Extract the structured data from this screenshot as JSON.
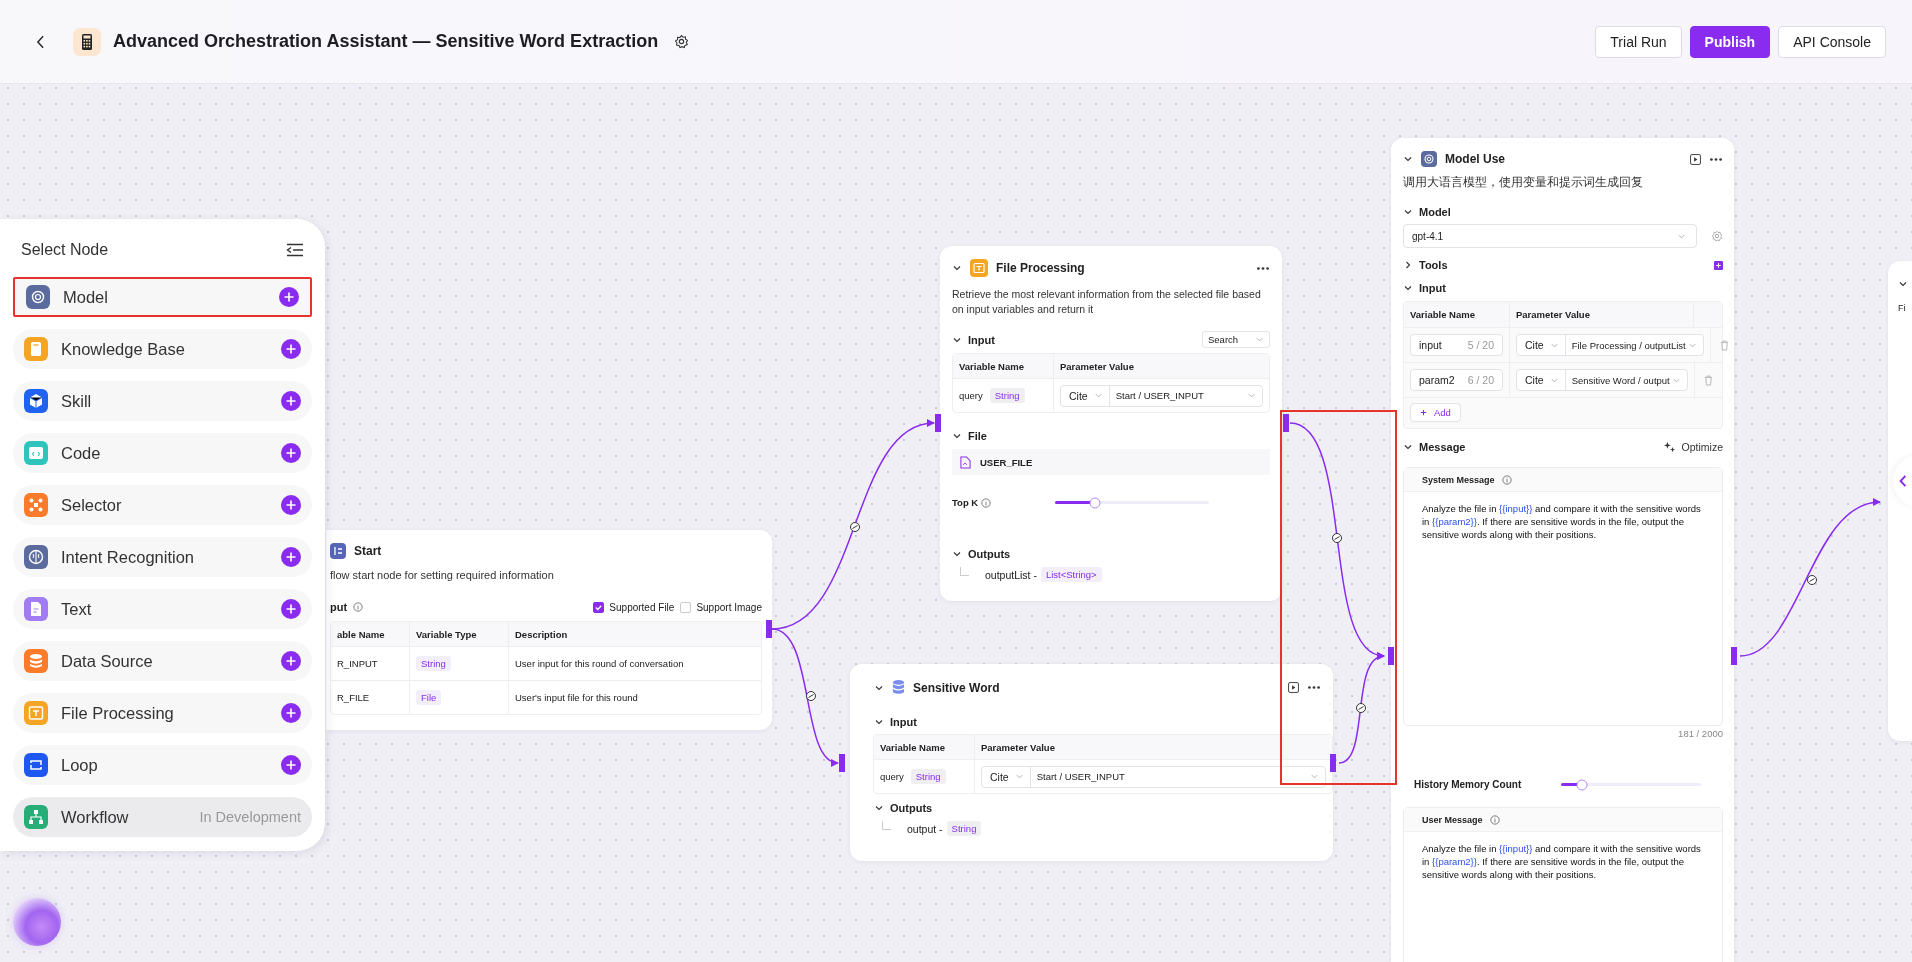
{
  "header": {
    "title": "Advanced Orchestration Assistant — Sensitive Word Extraction",
    "buttons": [
      {
        "label": "Trial Run",
        "kind": "secondary"
      },
      {
        "label": "Publish",
        "kind": "primary"
      },
      {
        "label": "API Console",
        "kind": "secondary"
      }
    ]
  },
  "node_picker": {
    "title": "Select Node",
    "items": [
      {
        "label": "Model",
        "color": "#5b6b9e",
        "highlighted": true,
        "disabled": false
      },
      {
        "label": "Knowledge Base",
        "color": "#f5a524",
        "highlighted": false,
        "disabled": false
      },
      {
        "label": "Skill",
        "color": "#1f63f0",
        "highlighted": false,
        "disabled": false
      },
      {
        "label": "Code",
        "color": "#2ec4bc",
        "highlighted": false,
        "disabled": false
      },
      {
        "label": "Selector",
        "color": "#fb7b2a",
        "highlighted": false,
        "disabled": false
      },
      {
        "label": "Intent Recognition",
        "color": "#5b6b9e",
        "highlighted": false,
        "disabled": false
      },
      {
        "label": "Text",
        "color": "#a27cf2",
        "highlighted": false,
        "disabled": false
      },
      {
        "label": "Data Source",
        "color": "#fb7b2a",
        "highlighted": false,
        "disabled": false
      },
      {
        "label": "File Processing",
        "color": "#f5a524",
        "highlighted": false,
        "disabled": false
      },
      {
        "label": "Loop",
        "color": "#1f58f0",
        "highlighted": false,
        "disabled": false
      },
      {
        "label": "Workflow",
        "color": "#27ae78",
        "highlighted": false,
        "disabled": true,
        "status": "In Development"
      }
    ]
  },
  "start_node": {
    "title": "Start",
    "description": "flow start node for setting required information",
    "section": "put",
    "options": [
      {
        "label": "Supported File",
        "checked": true
      },
      {
        "label": "Support Image",
        "checked": false
      }
    ],
    "columns": [
      "able Name",
      "Variable Type",
      "Description"
    ],
    "rows": [
      {
        "name": "R_INPUT",
        "type": "String",
        "description": "User input for this round of conversation"
      },
      {
        "name": "R_FILE",
        "type": "File",
        "description": "User's input file for this round"
      }
    ]
  },
  "file_processing": {
    "title": "File Processing",
    "description": "Retrieve the most relevant information from the selected file based on input variables and return it",
    "input_label": "Input",
    "mode": "Search",
    "columns": [
      "Variable Name",
      "Parameter Value"
    ],
    "rows": [
      {
        "name": "query",
        "type": "String",
        "source": "Cite",
        "value": "Start / USER_INPUT"
      }
    ],
    "file_label": "File",
    "file": "USER_FILE",
    "top_k": {
      "label": "Top K",
      "level": 0.26
    },
    "outputs_label": "Outputs",
    "outputs": [
      {
        "name": "outputList -",
        "type": "List<String>"
      }
    ]
  },
  "sensitive_word": {
    "title": "Sensitive Word",
    "input_label": "Input",
    "columns": [
      "Variable Name",
      "Parameter Value"
    ],
    "rows": [
      {
        "name": "query",
        "type": "String",
        "source": "Cite",
        "value": "Start / USER_INPUT"
      }
    ],
    "outputs_label": "Outputs",
    "outputs": [
      {
        "name": "output -",
        "type": "String"
      }
    ]
  },
  "model_use": {
    "title": "Model Use",
    "description": "调用大语言模型，使用变量和提示词生成回复",
    "model_label": "Model",
    "model": "gpt-4.1",
    "tools_label": "Tools",
    "tools_expanded": false,
    "input_label": "Input",
    "columns": [
      "Variable Name",
      "Parameter Value"
    ],
    "rows": [
      {
        "name": "input",
        "count": "5 / 20",
        "source": "Cite",
        "value": "File Processing / outputList"
      },
      {
        "name": "param2",
        "count": "6 / 20",
        "source": "Cite",
        "value": "Sensitive Word / output"
      }
    ],
    "add_label": "Add",
    "message_label": "Message",
    "optimize_label": "Optimize",
    "system_message": {
      "label": "System Message",
      "segments": [
        {
          "text": "Analyze the file in ",
          "kind": "plain"
        },
        {
          "text": "{{input}}",
          "kind": "variable"
        },
        {
          "text": " and compare it with the sensitive words in ",
          "kind": "plain"
        },
        {
          "text": "{{param2}}",
          "kind": "variable"
        },
        {
          "text": ". If there are sensitive words in the file, output the sensitive words along with their positions.",
          "kind": "plain"
        }
      ]
    },
    "counter": "181 / 2000",
    "history": {
      "label": "History Memory Count",
      "level": 0.15
    },
    "user_message": {
      "label": "User Message",
      "segments": [
        {
          "text": "Analyze the file in ",
          "kind": "plain"
        },
        {
          "text": "{{input}}",
          "kind": "variable"
        },
        {
          "text": " and compare it with the sensitive words in ",
          "kind": "plain"
        },
        {
          "text": "{{param2}}",
          "kind": "variable"
        },
        {
          "text": ". If there are sensitive words in the file, output the sensitive words along with their positions.",
          "kind": "plain"
        }
      ]
    }
  },
  "next_node": {
    "title": "Fi"
  }
}
